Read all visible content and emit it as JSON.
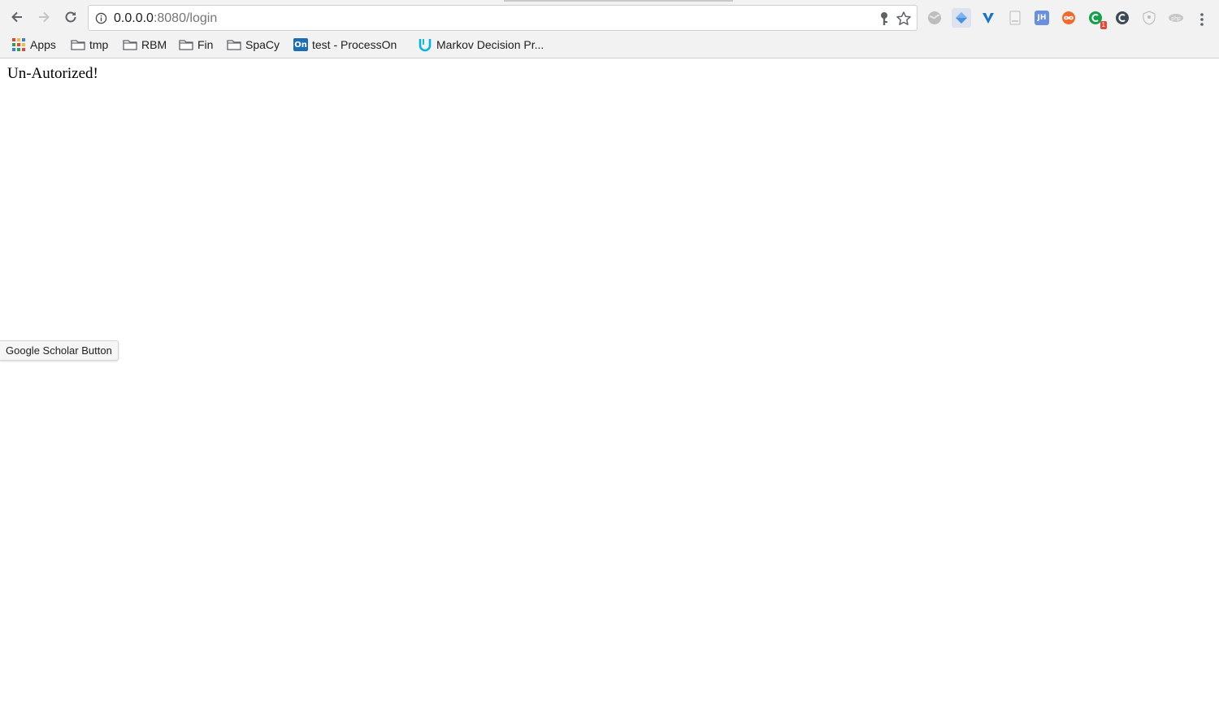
{
  "browser": {
    "url_host": "0.0.0.0",
    "url_path": ":8080/login",
    "extensions": [
      {
        "name": "globe-extension-icon"
      },
      {
        "name": "diamond-extension-icon"
      },
      {
        "name": "vimium-extension-icon"
      },
      {
        "name": "page-extension-icon"
      },
      {
        "name": "jsonhandle-extension-icon",
        "text": "JH"
      },
      {
        "name": "infinity-extension-icon"
      },
      {
        "name": "grammarly-extension-icon",
        "badge": "1"
      },
      {
        "name": "c-extension-icon"
      },
      {
        "name": "shield-extension-icon"
      },
      {
        "name": "php-extension-icon"
      }
    ]
  },
  "bookmarks": {
    "apps": "Apps",
    "items": [
      {
        "label": "tmp"
      },
      {
        "label": "RBM"
      },
      {
        "label": "Fin"
      },
      {
        "label": "SpaCy"
      },
      {
        "label": "test - ProcessOn",
        "icon_text": "On"
      },
      {
        "label": "Markov Decision Pr..."
      }
    ]
  },
  "page": {
    "message": "Un-Autorized!",
    "scholar_button": "Google Scholar Button"
  },
  "colors": {
    "chrome_bg": "#f2f2f2",
    "processon_blue": "#1b6db5",
    "udacity_cyan": "#02b3e4"
  }
}
